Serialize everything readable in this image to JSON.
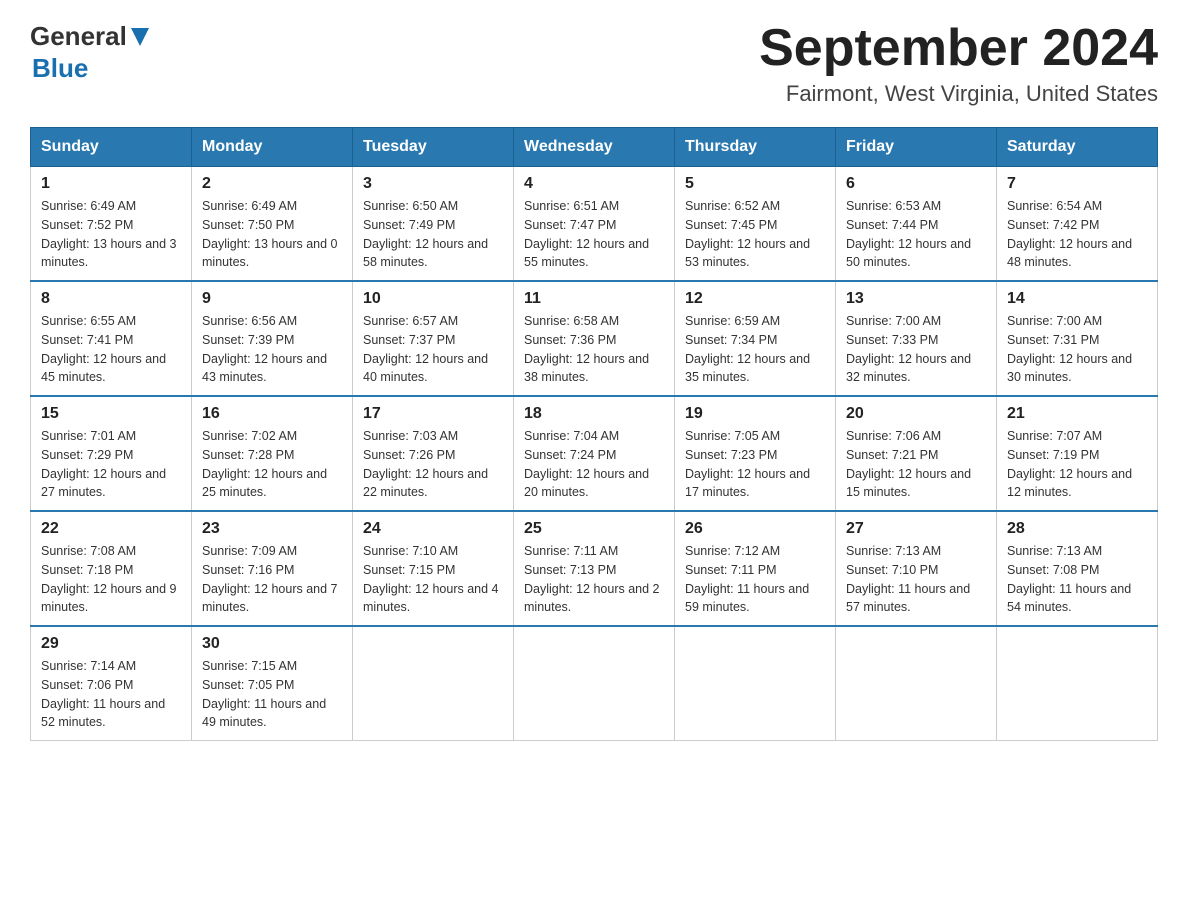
{
  "header": {
    "logo_general": "General",
    "logo_blue": "Blue",
    "month_year": "September 2024",
    "location": "Fairmont, West Virginia, United States"
  },
  "weekdays": [
    "Sunday",
    "Monday",
    "Tuesday",
    "Wednesday",
    "Thursday",
    "Friday",
    "Saturday"
  ],
  "weeks": [
    [
      {
        "day": "1",
        "sunrise": "Sunrise: 6:49 AM",
        "sunset": "Sunset: 7:52 PM",
        "daylight": "Daylight: 13 hours and 3 minutes."
      },
      {
        "day": "2",
        "sunrise": "Sunrise: 6:49 AM",
        "sunset": "Sunset: 7:50 PM",
        "daylight": "Daylight: 13 hours and 0 minutes."
      },
      {
        "day": "3",
        "sunrise": "Sunrise: 6:50 AM",
        "sunset": "Sunset: 7:49 PM",
        "daylight": "Daylight: 12 hours and 58 minutes."
      },
      {
        "day": "4",
        "sunrise": "Sunrise: 6:51 AM",
        "sunset": "Sunset: 7:47 PM",
        "daylight": "Daylight: 12 hours and 55 minutes."
      },
      {
        "day": "5",
        "sunrise": "Sunrise: 6:52 AM",
        "sunset": "Sunset: 7:45 PM",
        "daylight": "Daylight: 12 hours and 53 minutes."
      },
      {
        "day": "6",
        "sunrise": "Sunrise: 6:53 AM",
        "sunset": "Sunset: 7:44 PM",
        "daylight": "Daylight: 12 hours and 50 minutes."
      },
      {
        "day": "7",
        "sunrise": "Sunrise: 6:54 AM",
        "sunset": "Sunset: 7:42 PM",
        "daylight": "Daylight: 12 hours and 48 minutes."
      }
    ],
    [
      {
        "day": "8",
        "sunrise": "Sunrise: 6:55 AM",
        "sunset": "Sunset: 7:41 PM",
        "daylight": "Daylight: 12 hours and 45 minutes."
      },
      {
        "day": "9",
        "sunrise": "Sunrise: 6:56 AM",
        "sunset": "Sunset: 7:39 PM",
        "daylight": "Daylight: 12 hours and 43 minutes."
      },
      {
        "day": "10",
        "sunrise": "Sunrise: 6:57 AM",
        "sunset": "Sunset: 7:37 PM",
        "daylight": "Daylight: 12 hours and 40 minutes."
      },
      {
        "day": "11",
        "sunrise": "Sunrise: 6:58 AM",
        "sunset": "Sunset: 7:36 PM",
        "daylight": "Daylight: 12 hours and 38 minutes."
      },
      {
        "day": "12",
        "sunrise": "Sunrise: 6:59 AM",
        "sunset": "Sunset: 7:34 PM",
        "daylight": "Daylight: 12 hours and 35 minutes."
      },
      {
        "day": "13",
        "sunrise": "Sunrise: 7:00 AM",
        "sunset": "Sunset: 7:33 PM",
        "daylight": "Daylight: 12 hours and 32 minutes."
      },
      {
        "day": "14",
        "sunrise": "Sunrise: 7:00 AM",
        "sunset": "Sunset: 7:31 PM",
        "daylight": "Daylight: 12 hours and 30 minutes."
      }
    ],
    [
      {
        "day": "15",
        "sunrise": "Sunrise: 7:01 AM",
        "sunset": "Sunset: 7:29 PM",
        "daylight": "Daylight: 12 hours and 27 minutes."
      },
      {
        "day": "16",
        "sunrise": "Sunrise: 7:02 AM",
        "sunset": "Sunset: 7:28 PM",
        "daylight": "Daylight: 12 hours and 25 minutes."
      },
      {
        "day": "17",
        "sunrise": "Sunrise: 7:03 AM",
        "sunset": "Sunset: 7:26 PM",
        "daylight": "Daylight: 12 hours and 22 minutes."
      },
      {
        "day": "18",
        "sunrise": "Sunrise: 7:04 AM",
        "sunset": "Sunset: 7:24 PM",
        "daylight": "Daylight: 12 hours and 20 minutes."
      },
      {
        "day": "19",
        "sunrise": "Sunrise: 7:05 AM",
        "sunset": "Sunset: 7:23 PM",
        "daylight": "Daylight: 12 hours and 17 minutes."
      },
      {
        "day": "20",
        "sunrise": "Sunrise: 7:06 AM",
        "sunset": "Sunset: 7:21 PM",
        "daylight": "Daylight: 12 hours and 15 minutes."
      },
      {
        "day": "21",
        "sunrise": "Sunrise: 7:07 AM",
        "sunset": "Sunset: 7:19 PM",
        "daylight": "Daylight: 12 hours and 12 minutes."
      }
    ],
    [
      {
        "day": "22",
        "sunrise": "Sunrise: 7:08 AM",
        "sunset": "Sunset: 7:18 PM",
        "daylight": "Daylight: 12 hours and 9 minutes."
      },
      {
        "day": "23",
        "sunrise": "Sunrise: 7:09 AM",
        "sunset": "Sunset: 7:16 PM",
        "daylight": "Daylight: 12 hours and 7 minutes."
      },
      {
        "day": "24",
        "sunrise": "Sunrise: 7:10 AM",
        "sunset": "Sunset: 7:15 PM",
        "daylight": "Daylight: 12 hours and 4 minutes."
      },
      {
        "day": "25",
        "sunrise": "Sunrise: 7:11 AM",
        "sunset": "Sunset: 7:13 PM",
        "daylight": "Daylight: 12 hours and 2 minutes."
      },
      {
        "day": "26",
        "sunrise": "Sunrise: 7:12 AM",
        "sunset": "Sunset: 7:11 PM",
        "daylight": "Daylight: 11 hours and 59 minutes."
      },
      {
        "day": "27",
        "sunrise": "Sunrise: 7:13 AM",
        "sunset": "Sunset: 7:10 PM",
        "daylight": "Daylight: 11 hours and 57 minutes."
      },
      {
        "day": "28",
        "sunrise": "Sunrise: 7:13 AM",
        "sunset": "Sunset: 7:08 PM",
        "daylight": "Daylight: 11 hours and 54 minutes."
      }
    ],
    [
      {
        "day": "29",
        "sunrise": "Sunrise: 7:14 AM",
        "sunset": "Sunset: 7:06 PM",
        "daylight": "Daylight: 11 hours and 52 minutes."
      },
      {
        "day": "30",
        "sunrise": "Sunrise: 7:15 AM",
        "sunset": "Sunset: 7:05 PM",
        "daylight": "Daylight: 11 hours and 49 minutes."
      },
      null,
      null,
      null,
      null,
      null
    ]
  ]
}
